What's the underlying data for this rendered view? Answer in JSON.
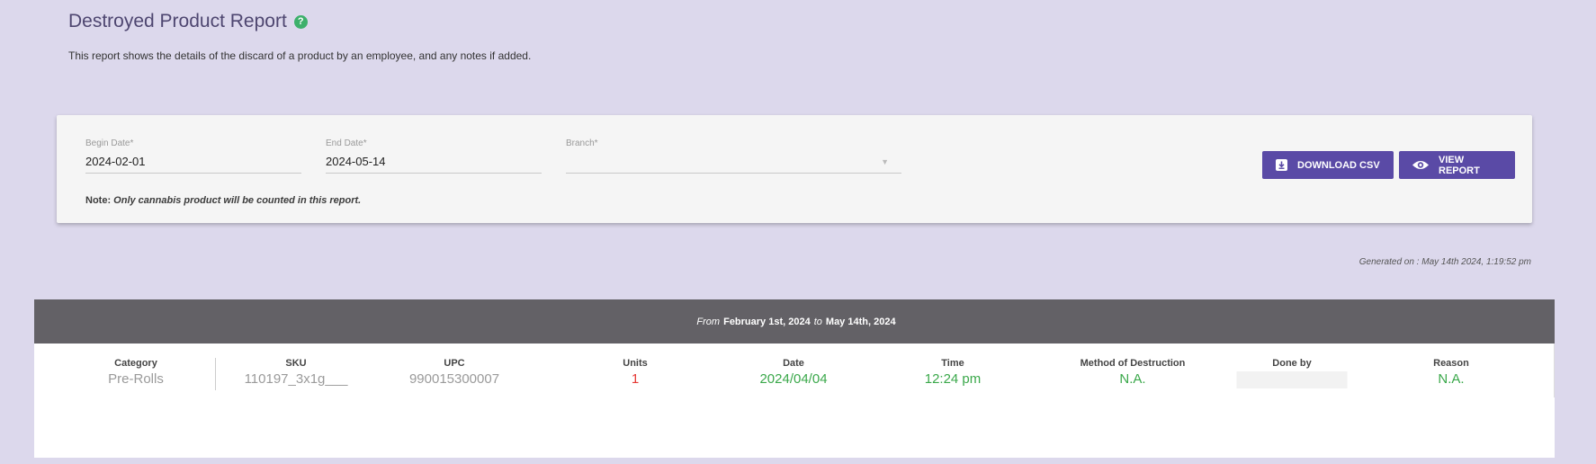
{
  "header": {
    "title": "Destroyed Product Report",
    "help_icon": "?",
    "subtitle": "This report shows the details of the discard of a product by an employee, and any notes if added."
  },
  "filters": {
    "begin_date": {
      "label": "Begin Date*",
      "value": "2024-02-01"
    },
    "end_date": {
      "label": "End Date*",
      "value": "2024-05-14"
    },
    "branch": {
      "label": "Branch*",
      "value": ""
    },
    "note_prefix": "Note:",
    "note_text": "Only cannabis product will be counted in this report."
  },
  "actions": {
    "download_csv": "DOWNLOAD CSV",
    "view_report": "VIEW REPORT"
  },
  "generated_on": "Generated on : May 14th 2024, 1:19:52 pm",
  "report": {
    "from_word": "From",
    "from_date": "February 1st, 2024",
    "to_word": "to",
    "to_date": "May 14th, 2024",
    "columns": [
      "Category",
      "SKU",
      "UPC",
      "Units",
      "Date",
      "Time",
      "Method of Destruction",
      "Done by",
      "Reason"
    ],
    "row": {
      "category": "Pre-Rolls",
      "sku": "110197_3x1g___",
      "upc": "990015300007",
      "units": "1",
      "date": "2024/04/04",
      "time": "12:24 pm",
      "method": "N.A.",
      "done_by": "",
      "reason": "N.A."
    }
  },
  "colors": {
    "background": "#dcd8ec",
    "accent": "#5a4aa6",
    "header_bar": "#636166",
    "green": "#3aa84a",
    "red": "#e53935"
  },
  "icons": {
    "help": "help-icon",
    "download": "download-icon",
    "view": "eye-icon",
    "dropdown": "chevron-down-icon"
  }
}
